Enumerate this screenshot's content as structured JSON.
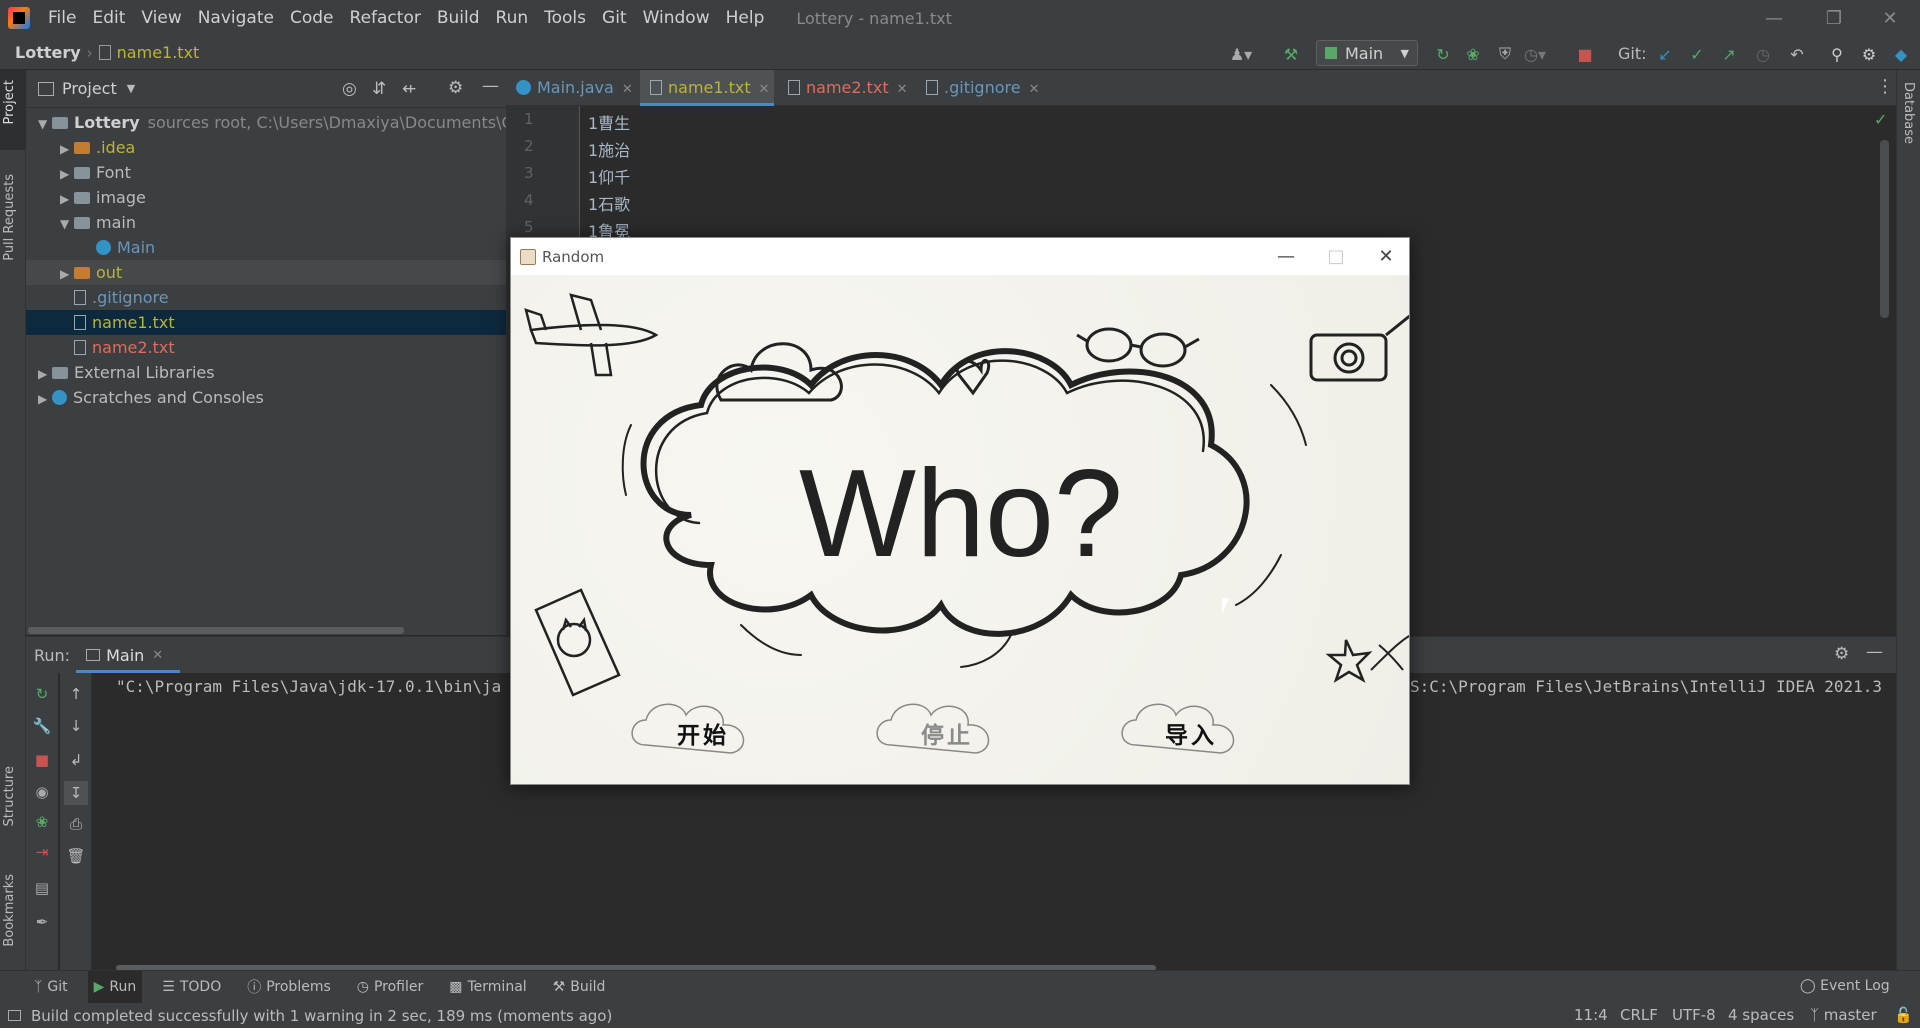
{
  "menubar": {
    "items": [
      "File",
      "Edit",
      "View",
      "Navigate",
      "Code",
      "Refactor",
      "Build",
      "Run",
      "Tools",
      "Git",
      "Window",
      "Help"
    ],
    "title": "Lottery - name1.txt"
  },
  "navbar": {
    "project": "Lottery",
    "file": "name1.txt",
    "run_config": "Main",
    "git_label": "Git:"
  },
  "project_panel": {
    "title": "Project",
    "tree": [
      {
        "label": "Lottery",
        "extra": "sources root,  C:\\Users\\Dmaxiya\\Documents\\GitHu",
        "color": "#d0d0d0"
      },
      {
        "label": ".idea",
        "color": "#bbb33a"
      },
      {
        "label": "Font",
        "color": "#bbbbbb"
      },
      {
        "label": "image",
        "color": "#bbbbbb"
      },
      {
        "label": "main",
        "color": "#bbbbbb"
      },
      {
        "label": "Main",
        "color": "#6897bb"
      },
      {
        "label": "out",
        "color": "#bbb33a"
      },
      {
        "label": ".gitignore",
        "color": "#6897bb"
      },
      {
        "label": "name1.txt",
        "color": "#bbb33a"
      },
      {
        "label": "name2.txt",
        "color": "#e06c5b"
      },
      {
        "label": "External Libraries",
        "color": "#bbbbbb"
      },
      {
        "label": "Scratches and Consoles",
        "color": "#bbbbbb"
      }
    ]
  },
  "editor": {
    "tabs": [
      {
        "label": "Main.java",
        "color": "#6897bb"
      },
      {
        "label": "name1.txt",
        "color": "#bbb33a"
      },
      {
        "label": "name2.txt",
        "color": "#e06c5b"
      },
      {
        "label": ".gitignore",
        "color": "#6897bb"
      }
    ],
    "line_numbers": [
      "1",
      "2",
      "3",
      "4",
      "5"
    ],
    "lines": [
      "1曹生",
      "1施治",
      "1仰千",
      "1石歌",
      "1鲁冕"
    ]
  },
  "run_panel": {
    "label": "Run:",
    "tab": "Main",
    "console_left": "\"C:\\Program Files\\Java\\jdk-17.0.1\\bin\\ja",
    "console_right": "S:C:\\Program Files\\JetBrains\\IntelliJ IDEA 2021.3"
  },
  "left_strip": {
    "project": "Project",
    "pull_requests": "Pull Requests",
    "structure": "Structure",
    "bookmarks": "Bookmarks"
  },
  "right_strip": {
    "database": "Database"
  },
  "bottom_tabs": [
    "Git",
    "Run",
    "TODO",
    "Problems",
    "Profiler",
    "Terminal",
    "Build"
  ],
  "event_log": "Event Log",
  "status": {
    "message": "Build completed successfully with 1 warning in 2 sec, 189 ms (moments ago)",
    "position": "11:4",
    "line_sep": "CRLF",
    "encoding": "UTF-8",
    "indent": "4 spaces",
    "branch": "master"
  },
  "random_window": {
    "title": "Random",
    "headline": "Who?",
    "buttons": [
      "开始",
      "停止",
      "导入"
    ]
  }
}
